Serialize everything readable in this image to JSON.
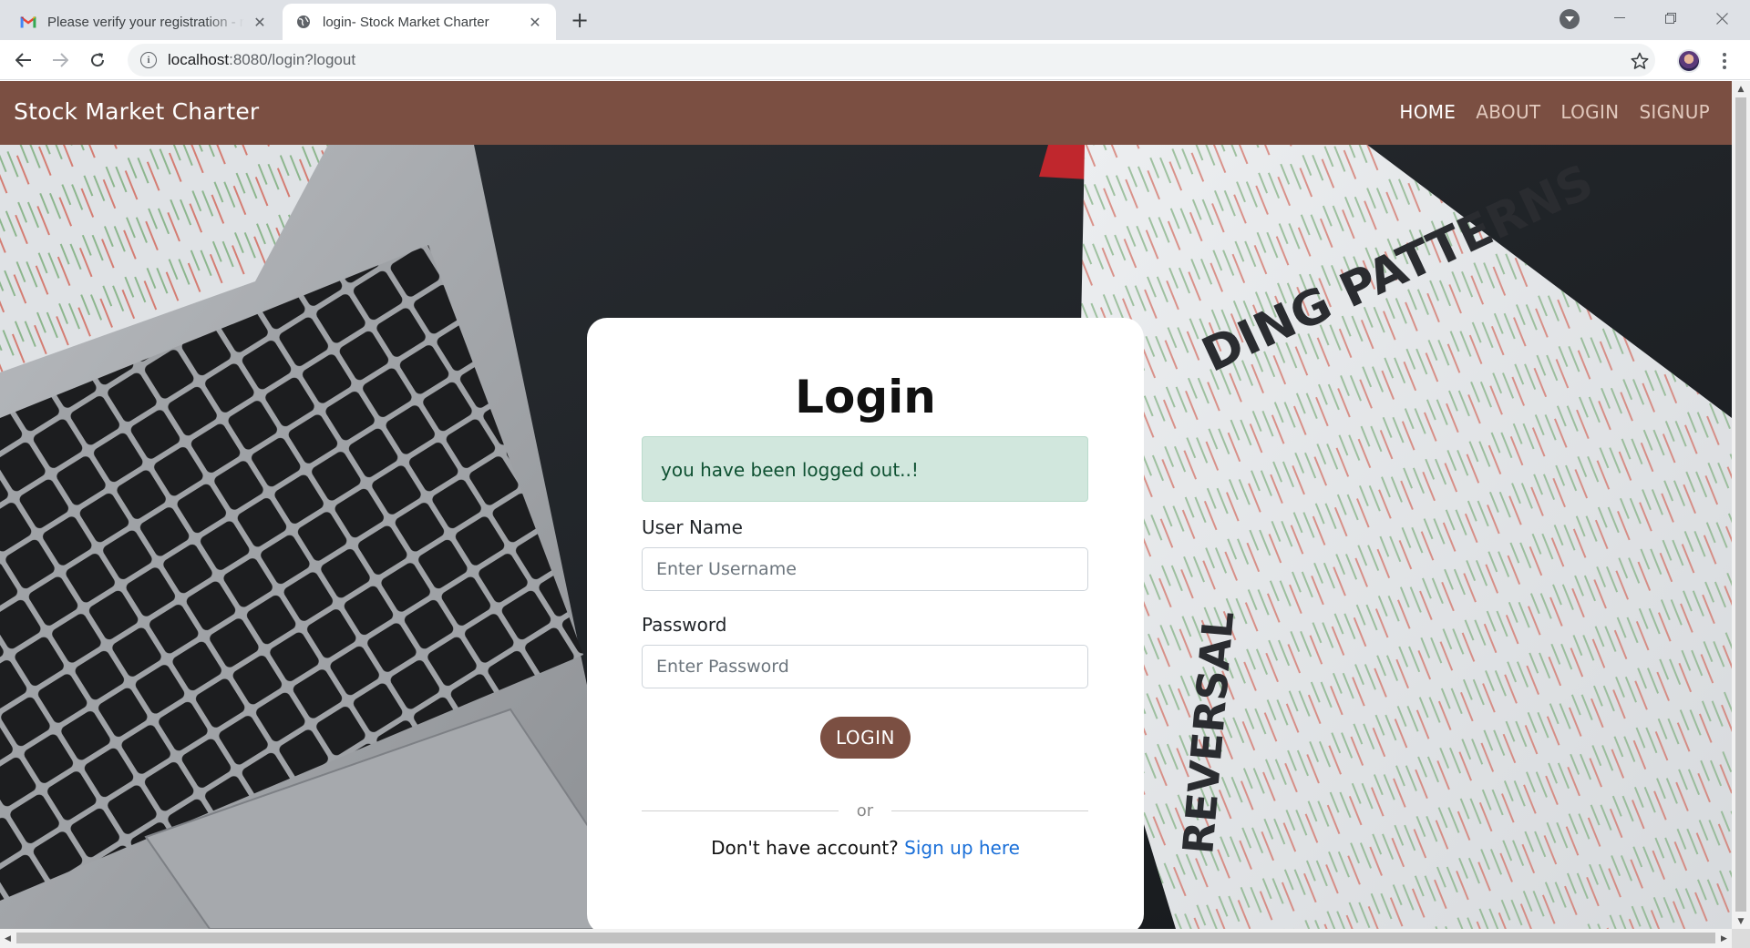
{
  "browser": {
    "tabs": [
      {
        "title": "Please verify your registration - m",
        "icon": "gmail-icon",
        "active": false
      },
      {
        "title": "login- Stock Market Charter",
        "icon": "globe-icon",
        "active": true
      }
    ],
    "url_host": "localhost",
    "url_rest": ":8080/login?logout"
  },
  "site": {
    "brand": "Stock Market Charter",
    "nav": [
      "HOME",
      "ABOUT",
      "LOGIN",
      "SIGNUP"
    ],
    "active_nav": "HOME",
    "brand_color": "#7b4f42"
  },
  "login": {
    "title": "Login",
    "alert": "you have been logged out..!",
    "username_label": "User Name",
    "username_placeholder": "Enter Username",
    "username_value": "",
    "password_label": "Password",
    "password_placeholder": "Enter Password",
    "password_value": "",
    "submit_label": "LOGIN",
    "divider_text": "or",
    "signup_prompt": "Don't have account?",
    "signup_link": "Sign up here"
  }
}
